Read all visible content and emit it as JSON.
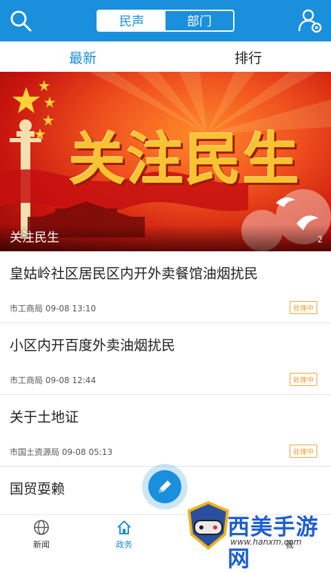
{
  "header": {
    "segments": [
      {
        "label": "民声",
        "active": true
      },
      {
        "label": "部门",
        "active": false
      }
    ],
    "icons": {
      "left": "search-icon",
      "right": "user-settings-icon"
    },
    "accent": "#1a8fdc"
  },
  "subtabs": [
    {
      "label": "最新",
      "active": true
    },
    {
      "label": "排行",
      "active": false
    }
  ],
  "banner": {
    "title": "关注民生",
    "caption": "关注民生",
    "page_indicator": "2"
  },
  "list": [
    {
      "title": "皇姑岭社区居民区内开外卖餐馆油烟扰民",
      "meta": "市工商局 09-08 13:10",
      "status": "处理中"
    },
    {
      "title": "小区内开百度外卖油烟扰民",
      "meta": "市工商局 09-08 12:44",
      "status": "处理中"
    },
    {
      "title": "关于土地证",
      "meta": "市国土资源局 09-08 05:13",
      "status": "处理中"
    },
    {
      "title": "国贸耍赖",
      "meta": "",
      "status": ""
    }
  ],
  "fab": {
    "icon": "pencil-icon"
  },
  "bottom_nav": [
    {
      "label": "新闻",
      "icon": "globe-icon",
      "active": false
    },
    {
      "label": "政务",
      "icon": "home-icon",
      "active": true
    },
    {
      "label": "我",
      "icon": "person-icon",
      "active": false
    }
  ],
  "watermark": {
    "text": "西美手游网",
    "url": "www.hanxm.com"
  }
}
